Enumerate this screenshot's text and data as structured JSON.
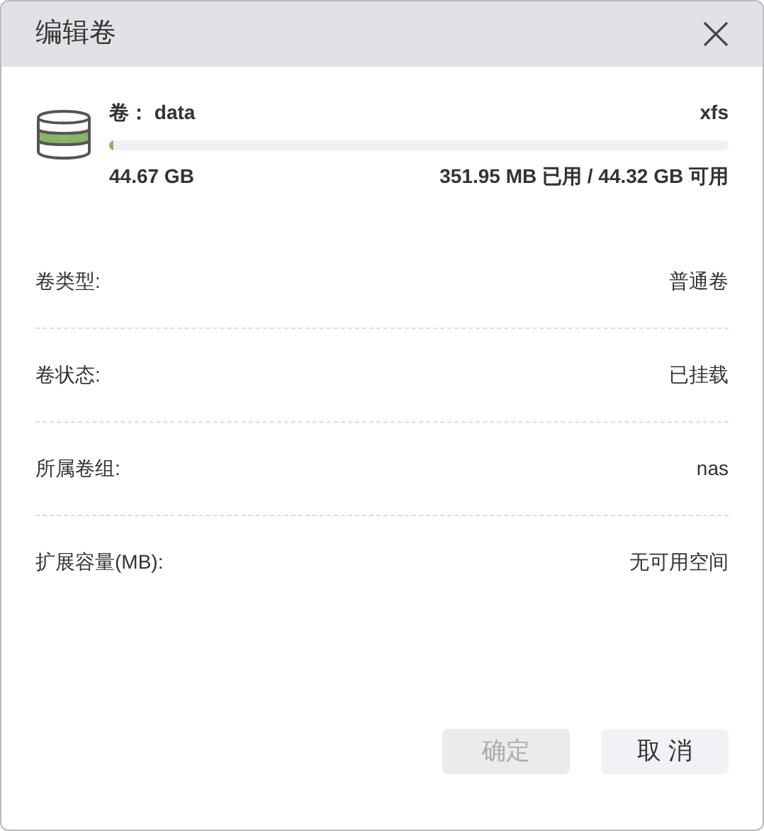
{
  "window": {
    "title": "编辑卷"
  },
  "volume": {
    "name_label": "卷：",
    "name": "data",
    "filesystem": "xfs",
    "level": 0.008,
    "total": "44.67 GB",
    "usage": "351.95 MB 已用 / 44.32 GB 可用"
  },
  "fields": [
    {
      "label": "卷类型:",
      "value": "普通卷"
    },
    {
      "label": "卷状态:",
      "value": "已挂载"
    },
    {
      "label": "所属卷组:",
      "value": "nas"
    },
    {
      "label": "扩展容量(MB):",
      "value": "无可用空间"
    }
  ],
  "buttons": [
    {
      "label": "确定",
      "disabled": true
    },
    {
      "label": "取 消",
      "disabled": false
    }
  ]
}
